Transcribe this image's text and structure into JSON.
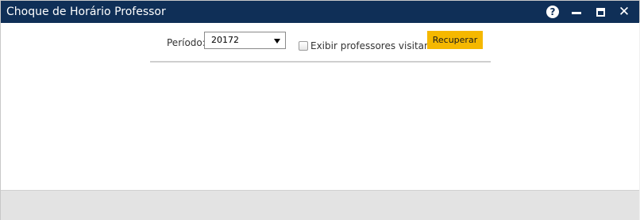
{
  "window": {
    "title": "Choque de Horário Professor",
    "controls": {
      "help_icon": "question-circle-icon",
      "help_glyph": "?",
      "minimize_icon": "minimize-icon",
      "maximize_icon": "maximize-icon",
      "close_icon": "close-icon",
      "close_glyph": "✕"
    }
  },
  "filters": {
    "periodo_label": "Período:",
    "periodo_value": "20172",
    "checkbox_label": "Exibir professores visitantes",
    "checkbox_checked": false,
    "button_label": "Recuperar"
  },
  "colors": {
    "titlebar": "#0f2f57",
    "button": "#f5b800",
    "footer": "#e3e3e3"
  }
}
